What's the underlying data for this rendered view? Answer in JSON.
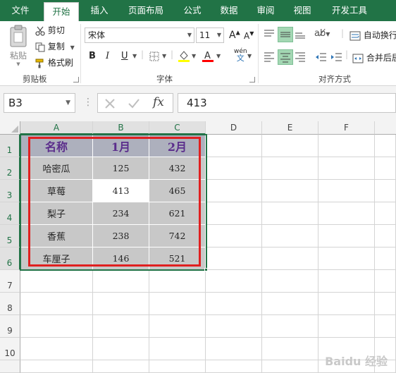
{
  "ribbon_tabs": [
    {
      "label": "文件"
    },
    {
      "label": "开始"
    },
    {
      "label": "插入"
    },
    {
      "label": "页面布局"
    },
    {
      "label": "公式"
    },
    {
      "label": "数据"
    },
    {
      "label": "审阅"
    },
    {
      "label": "视图"
    },
    {
      "label": "开发工具"
    }
  ],
  "active_tab": "开始",
  "clipboard": {
    "paste_label": "粘贴",
    "cut_label": "剪切",
    "copy_label": "复制",
    "format_painter_label": "格式刷",
    "group_label": "剪贴板"
  },
  "font": {
    "font_name": "宋体",
    "font_size": "11",
    "bold": "B",
    "italic": "I",
    "underline": "U",
    "group_label": "字体",
    "phonetic": "wén"
  },
  "alignment": {
    "wrap_text_label": "自动换行",
    "merge_label": "合并后居",
    "group_label": "对齐方式"
  },
  "formula_bar": {
    "name_box": "B3",
    "fx_label": "fx",
    "formula": "413"
  },
  "columns": [
    "A",
    "B",
    "C",
    "D",
    "E",
    "F"
  ],
  "rows": [
    "1",
    "2",
    "3",
    "4",
    "5",
    "6",
    "7",
    "8",
    "9",
    "10"
  ],
  "table": {
    "headers": [
      "名称",
      "1月",
      "2月"
    ],
    "rows": [
      [
        "哈密瓜",
        "125",
        "432"
      ],
      [
        "草莓",
        "413",
        "465"
      ],
      [
        "梨子",
        "234",
        "621"
      ],
      [
        "香蕉",
        "238",
        "742"
      ],
      [
        "车厘子",
        "146",
        "521"
      ]
    ]
  },
  "colors": {
    "accent": "#217346",
    "header_fill": "#adb0bd",
    "header_text": "#5b2d8c",
    "data_fill": "#c8c8c8",
    "highlight_border": "#e02020",
    "fill_color_swatch": "#ffff00",
    "font_color_swatch": "#ff0000"
  },
  "watermark": "Baidu 经验"
}
